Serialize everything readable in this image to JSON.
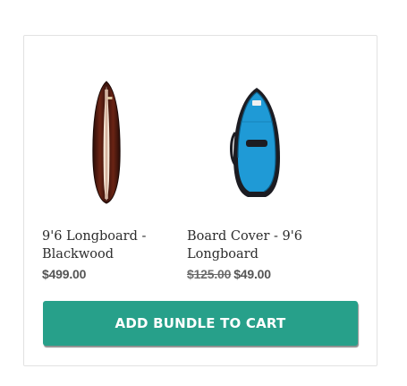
{
  "bundle": {
    "products": [
      {
        "title_line1": "9'6 Longboard -",
        "title_line2": "Blackwood",
        "price": "$499.00",
        "image_icon": "longboard-surfboard-image"
      },
      {
        "title_line1": "Board Cover - 9'6",
        "title_line2": "Longboard",
        "compare_at_price": "$125.00",
        "price": "$49.00",
        "image_icon": "board-cover-bag-image"
      }
    ],
    "add_button_label": "ADD BUNDLE TO CART",
    "colors": {
      "button": "#27a08a",
      "board_wood": "#4a1a12",
      "board_stripe": "#f4e6d6",
      "cover_blue": "#1f9ad6",
      "cover_dark": "#1c1c22"
    }
  }
}
